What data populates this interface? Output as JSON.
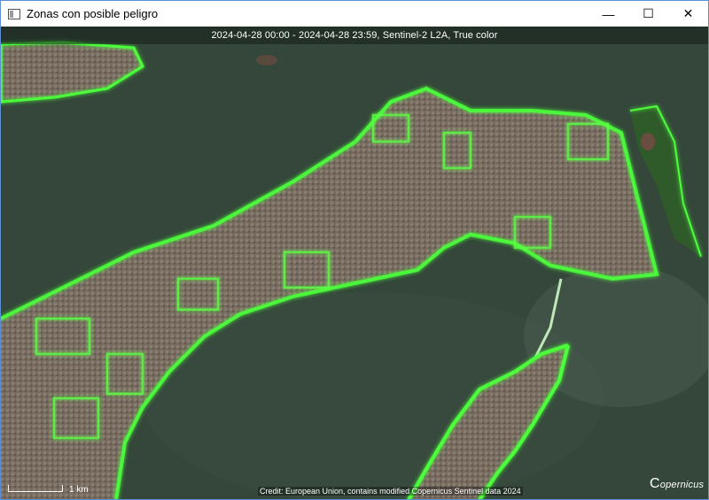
{
  "window": {
    "title": "Zonas con posible peligro",
    "controls": {
      "minimize": "—",
      "maximize": "☐",
      "close": "✕"
    }
  },
  "map": {
    "date_banner": "2024-04-28 00:00 - 2024-04-28 23:59, Sentinel-2 L2A, True color",
    "scale_label": "1 km",
    "credit": "Credit: European Union, contains modified Copernicus Sentinel data 2024",
    "logo_text": "opernicus",
    "logo_initial": "C",
    "colors": {
      "water": "#2f4335",
      "land": "#7a6f63",
      "highlight": "#4cff3a",
      "vegetation": "#2f5a2a"
    }
  }
}
